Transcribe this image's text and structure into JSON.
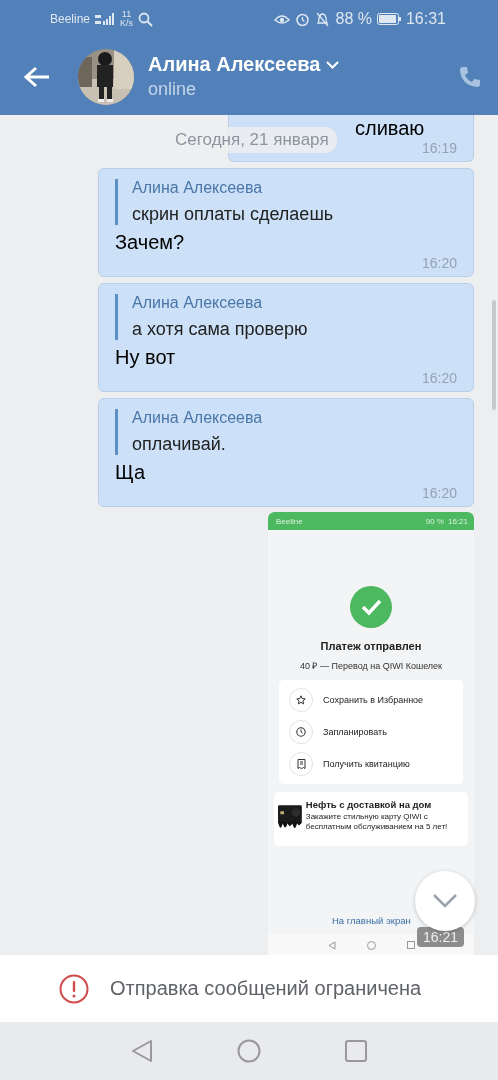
{
  "status_bar": {
    "carrier": "Beeline",
    "speed": "11",
    "speed_unit": "K/s",
    "battery": "88 %",
    "time": "16:31"
  },
  "header": {
    "name": "Алина Алексеева",
    "status": "online"
  },
  "date_pill": "Сегодня, 21 января",
  "messages": [
    {
      "kind": "text",
      "text": "сливаю",
      "time": "16:19"
    },
    {
      "kind": "reply",
      "quote_author": "Алина Алексеева",
      "quote": "скрин оплаты сделаешь",
      "text": "Зачем?",
      "time": "16:20"
    },
    {
      "kind": "reply",
      "quote_author": "Алина Алексеева",
      "quote": "а хотя сама проверю",
      "text": "Ну вот",
      "time": "16:20"
    },
    {
      "kind": "reply",
      "quote_author": "Алина Алексеева",
      "quote": "оплачивай.",
      "text": "Ща",
      "time": "16:20"
    },
    {
      "kind": "screenshot",
      "time": "16:21",
      "screenshot": {
        "status": {
          "carrier": "Beeline",
          "battery": "90 %",
          "time": "16:21"
        },
        "title": "Платеж отправлен",
        "subtitle": "40 ₽ — Перевод на QIWI Кошелек",
        "actions": [
          {
            "kind": "star",
            "label": "Сохранить в Избранное"
          },
          {
            "kind": "clock",
            "label": "Запланировать"
          },
          {
            "kind": "receipt",
            "label": "Получить квитанцию"
          }
        ],
        "promo": {
          "title": "Нефть с доставкой на дом",
          "text": "Закажите стильную карту QIWI с бесплатным обслуживанием на 5 лет!"
        },
        "link": "На главный экран"
      }
    }
  ],
  "footer": {
    "notice": "Отправка сообщений ограничена"
  }
}
